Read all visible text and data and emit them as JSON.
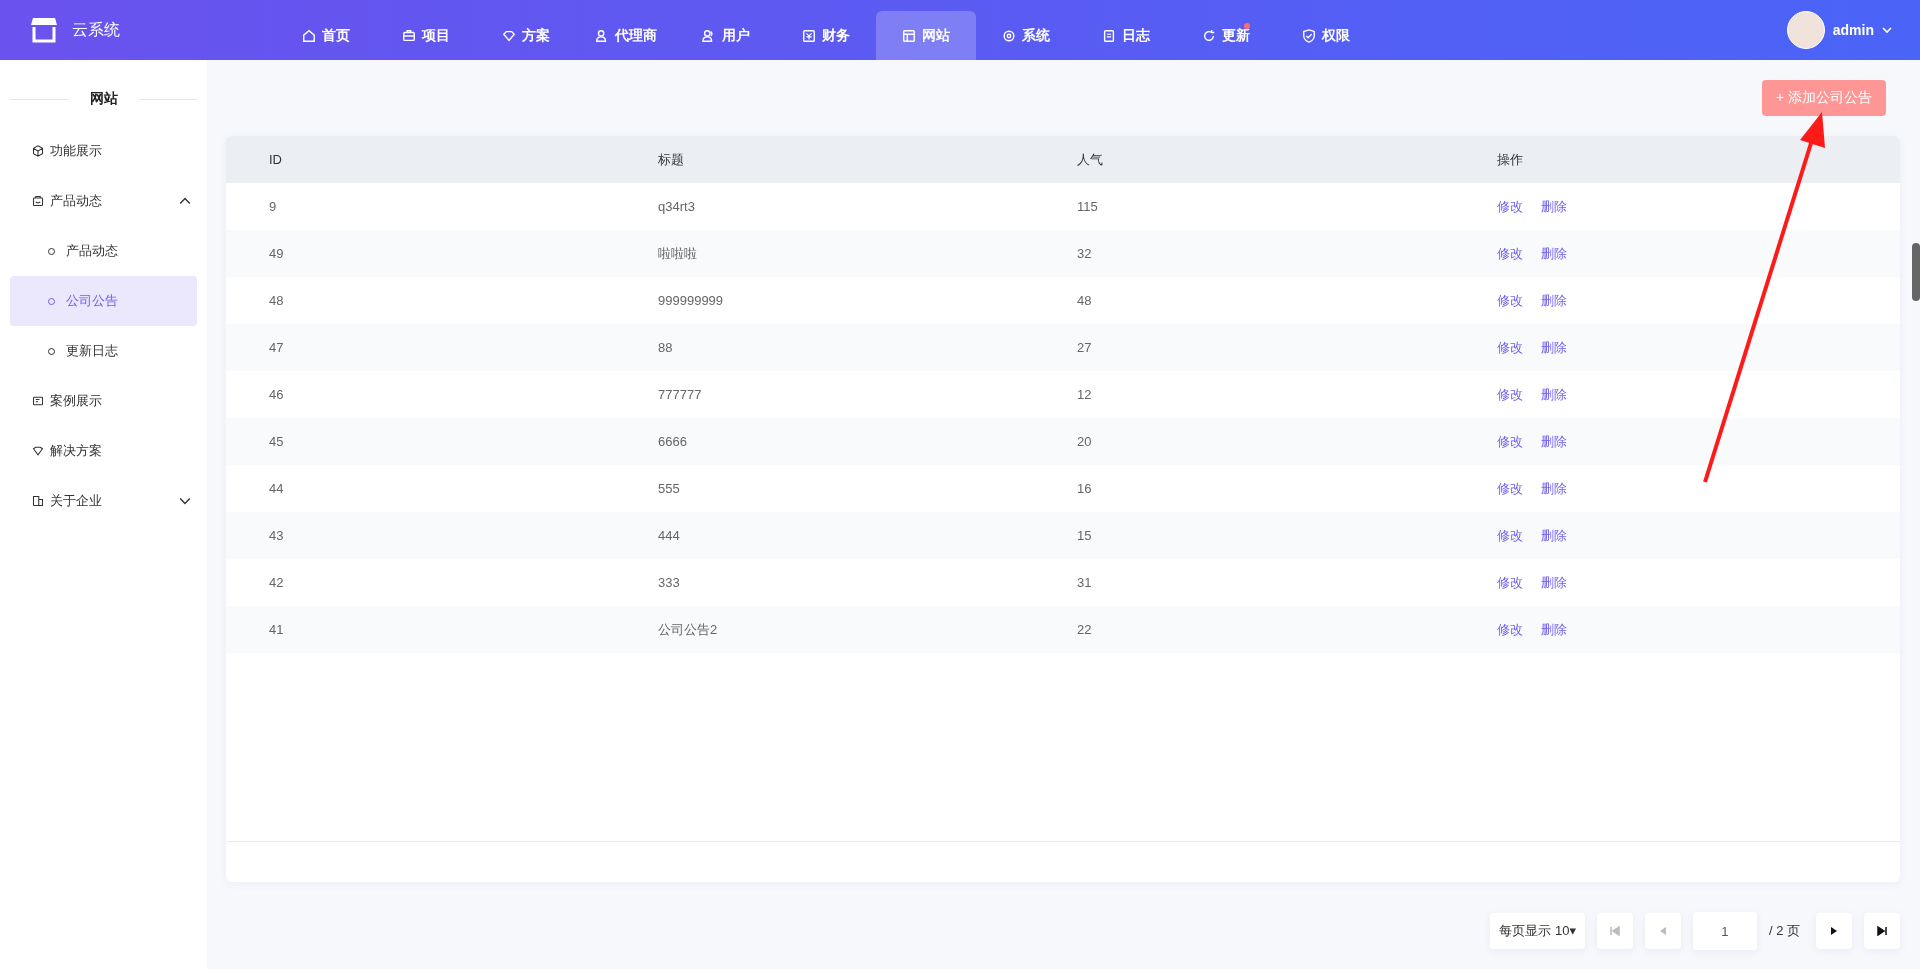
{
  "header": {
    "logo_text": "云系统",
    "nav": [
      {
        "label": "首页",
        "selected": false,
        "badge": false
      },
      {
        "label": "项目",
        "selected": false,
        "badge": false
      },
      {
        "label": "方案",
        "selected": false,
        "badge": false
      },
      {
        "label": "代理商",
        "selected": false,
        "badge": false
      },
      {
        "label": "用户",
        "selected": false,
        "badge": false
      },
      {
        "label": "财务",
        "selected": false,
        "badge": false
      },
      {
        "label": "网站",
        "selected": true,
        "badge": false
      },
      {
        "label": "系统",
        "selected": false,
        "badge": false
      },
      {
        "label": "日志",
        "selected": false,
        "badge": false
      },
      {
        "label": "更新",
        "selected": false,
        "badge": true
      },
      {
        "label": "权限",
        "selected": false,
        "badge": false
      }
    ],
    "user": {
      "name": "admin"
    }
  },
  "sidebar": {
    "title": "网站",
    "items": [
      {
        "label": "功能展示",
        "selected": false
      },
      {
        "label": "产品动态",
        "selected": false,
        "expanded": true,
        "children": [
          {
            "label": "产品动态",
            "selected": false
          },
          {
            "label": "公司公告",
            "selected": true
          },
          {
            "label": "更新日志",
            "selected": false
          }
        ]
      },
      {
        "label": "案例展示",
        "selected": false
      },
      {
        "label": "解决方案",
        "selected": false
      },
      {
        "label": "关于企业",
        "selected": false,
        "expanded": false
      }
    ]
  },
  "add_button": "+ 添加公司公告",
  "table": {
    "columns": [
      "ID",
      "标题",
      "人气",
      "操作"
    ],
    "rows": [
      {
        "id": "9",
        "title": "q34rt3",
        "views": "115",
        "actions": [
          "修改",
          "删除"
        ]
      },
      {
        "id": "49",
        "title": "啦啦啦",
        "views": "32",
        "actions": [
          "修改",
          "删除"
        ]
      },
      {
        "id": "48",
        "title": "999999999",
        "views": "48",
        "actions": [
          "修改",
          "删除"
        ]
      },
      {
        "id": "47",
        "title": "88",
        "views": "27",
        "actions": [
          "修改",
          "删除"
        ]
      },
      {
        "id": "46",
        "title": "777777",
        "views": "12",
        "actions": [
          "修改",
          "删除"
        ]
      },
      {
        "id": "45",
        "title": "6666",
        "views": "20",
        "actions": [
          "修改",
          "删除"
        ]
      },
      {
        "id": "44",
        "title": "555",
        "views": "16",
        "actions": [
          "修改",
          "删除"
        ]
      },
      {
        "id": "43",
        "title": "444",
        "views": "15",
        "actions": [
          "修改",
          "删除"
        ]
      },
      {
        "id": "42",
        "title": "333",
        "views": "31",
        "actions": [
          "修改",
          "删除"
        ]
      },
      {
        "id": "41",
        "title": "公司公告2",
        "views": "22",
        "actions": [
          "修改",
          "删除"
        ]
      }
    ]
  },
  "pagination": {
    "page_size": "每页显示 10▾",
    "page": "1",
    "total": "/ 2 页",
    "buttons": [
      {
        "kind": "first",
        "disabled": true
      },
      {
        "kind": "prev",
        "disabled": true
      },
      {
        "kind": "next",
        "disabled": false
      },
      {
        "kind": "last",
        "disabled": false
      }
    ]
  }
}
